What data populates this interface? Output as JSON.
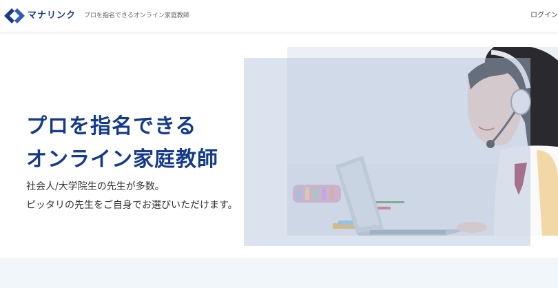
{
  "header": {
    "logo_text": "マナリンク",
    "tagline": "プロを指名できるオンライン家庭教師",
    "login_label": "ログイン"
  },
  "hero": {
    "headline_line1": "プロを指名できる",
    "headline_line2": "オンライン家庭教師",
    "subcopy_line1": "社会人/大学院生の先生が多数。",
    "subcopy_line2": "ピッタリの先生をご自身でお選びいただけます。"
  },
  "colors": {
    "brand": "#1a3a8a",
    "headline": "#153a8c",
    "overlay": "#b0c0dc",
    "section_bg": "#f1f6fb"
  },
  "icons": {
    "logo": "manalink-diamond-logo-icon"
  }
}
